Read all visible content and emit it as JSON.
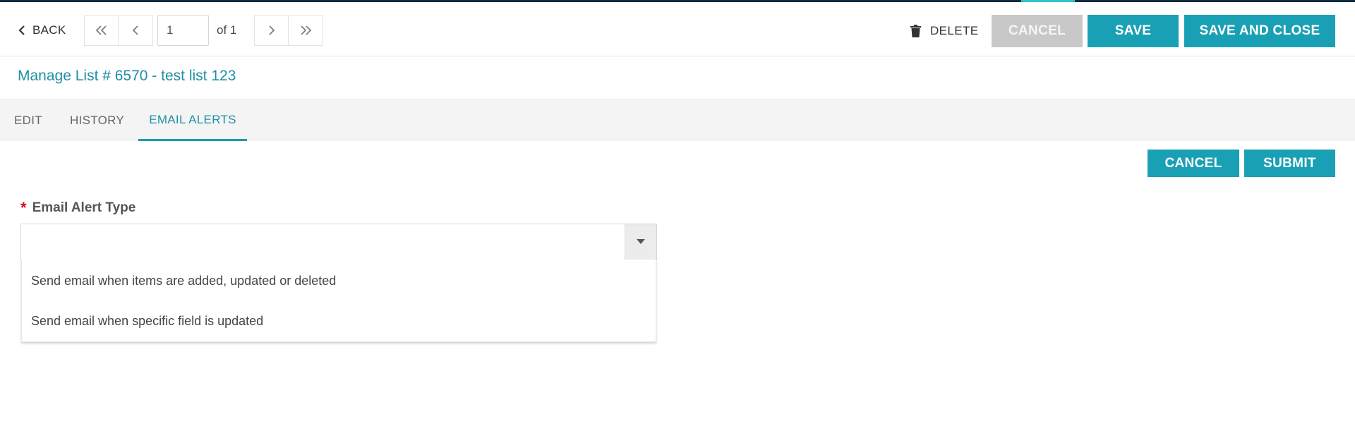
{
  "toolbar": {
    "back_label": "BACK",
    "page_value": "1",
    "page_of": "of 1",
    "delete_label": "DELETE",
    "cancel_label": "CANCEL",
    "save_label": "SAVE",
    "save_close_label": "SAVE AND CLOSE"
  },
  "page_title": "Manage List # 6570 - test list 123",
  "tabs": [
    {
      "label": "EDIT",
      "active": false
    },
    {
      "label": "HISTORY",
      "active": false
    },
    {
      "label": "EMAIL ALERTS",
      "active": true
    }
  ],
  "form": {
    "cancel_label": "CANCEL",
    "submit_label": "SUBMIT",
    "required_marker": "*",
    "email_alert_type": {
      "label": "Email Alert Type",
      "value": "",
      "options": [
        "Send email when items are added, updated or deleted",
        "Send email when specific field is updated"
      ]
    }
  },
  "colors": {
    "accent": "#1aa0b4",
    "title": "#1e8fa6",
    "disabled_button": "#c8c8c8",
    "required": "#c8102e",
    "top_line": "#0f2b3d"
  }
}
